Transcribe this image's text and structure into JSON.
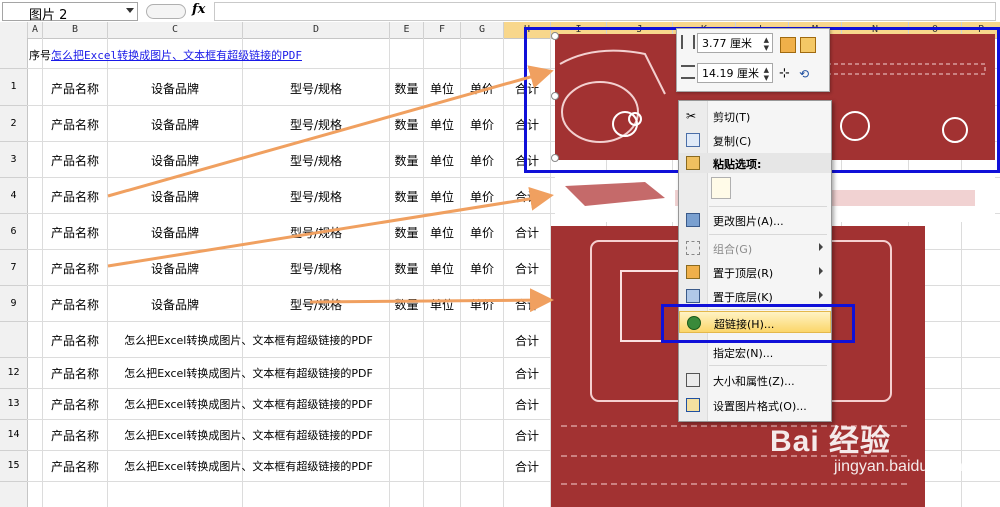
{
  "namebox": {
    "value": "图片 2"
  },
  "formula": {
    "fx": "fx",
    "value": ""
  },
  "columns": [
    "A",
    "B",
    "C",
    "D",
    "E",
    "F",
    "G",
    "H",
    "I",
    "J",
    "K",
    "L",
    "M",
    "N",
    "O",
    "P"
  ],
  "title_row": {
    "prefix": "序号",
    "link": "怎么把Excel转换成图片、文本框有超级链接的PDF"
  },
  "rows": [
    {
      "num": "1",
      "b": "产品名称",
      "c": "设备品牌",
      "d": "型号/规格",
      "e": "数量",
      "f": "单位",
      "g": "单价",
      "h": "合计"
    },
    {
      "num": "2",
      "b": "产品名称",
      "c": "设备品牌",
      "d": "型号/规格",
      "e": "数量",
      "f": "单位",
      "g": "单价",
      "h": "合计"
    },
    {
      "num": "3",
      "b": "产品名称",
      "c": "设备品牌",
      "d": "型号/规格",
      "e": "数量",
      "f": "单位",
      "g": "单价",
      "h": "合计"
    },
    {
      "num": "4",
      "b": "产品名称",
      "c": "设备品牌",
      "d": "型号/规格",
      "e": "数量",
      "f": "单位",
      "g": "单价",
      "h": "合计"
    },
    {
      "num": "6",
      "b": "产品名称",
      "c": "设备品牌",
      "d": "型号/规格",
      "e": "数量",
      "f": "单位",
      "g": "单价",
      "h": "合计"
    },
    {
      "num": "7",
      "b": "产品名称",
      "c": "设备品牌",
      "d": "型号/规格",
      "e": "数量",
      "f": "单位",
      "g": "单价",
      "h": "合计"
    },
    {
      "num": "9",
      "b": "产品名称",
      "c": "设备品牌",
      "d": "型号/规格",
      "e": "数量",
      "f": "单位",
      "g": "单价",
      "h": "合计"
    },
    {
      "num": "",
      "b": "产品名称",
      "c": "怎么把Excel转换成图片、文本框有超级链接的PDF",
      "h": "合计"
    },
    {
      "num": "12",
      "b": "产品名称",
      "c": "怎么把Excel转换成图片、文本框有超级链接的PDF",
      "h": "合计"
    },
    {
      "num": "13",
      "b": "产品名称",
      "c": "怎么把Excel转换成图片、文本框有超级链接的PDF",
      "h": "合计"
    },
    {
      "num": "14",
      "b": "产品名称",
      "c": "怎么把Excel转换成图片、文本框有超级链接的PDF",
      "h": "合计"
    },
    {
      "num": "15",
      "b": "产品名称",
      "c": "怎么把Excel转换成图片、文本框有超级链接的PDF",
      "h": "合计"
    }
  ],
  "minitoolbar": {
    "height": "3.77 厘米",
    "width": "14.19 厘米"
  },
  "menu": {
    "cut": "剪切(T)",
    "copy": "复制(C)",
    "paste_header": "粘贴选项:",
    "change_picture": "更改图片(A)...",
    "group": "组合(G)",
    "bring_front": "置于顶层(R)",
    "send_back": "置于底层(K)",
    "hyperlink": "超链接(H)...",
    "assign_macro": "指定宏(N)...",
    "size_props": "大小和属性(Z)...",
    "format_picture": "设置图片格式(O)..."
  },
  "watermark": {
    "brand": "Bai 经验",
    "url": "jingyan.baidu.com"
  },
  "colors": {
    "selection": "#1010d8",
    "arrow": "#f0a060",
    "red_arrow": "#e02020",
    "picture": "#a23232"
  }
}
